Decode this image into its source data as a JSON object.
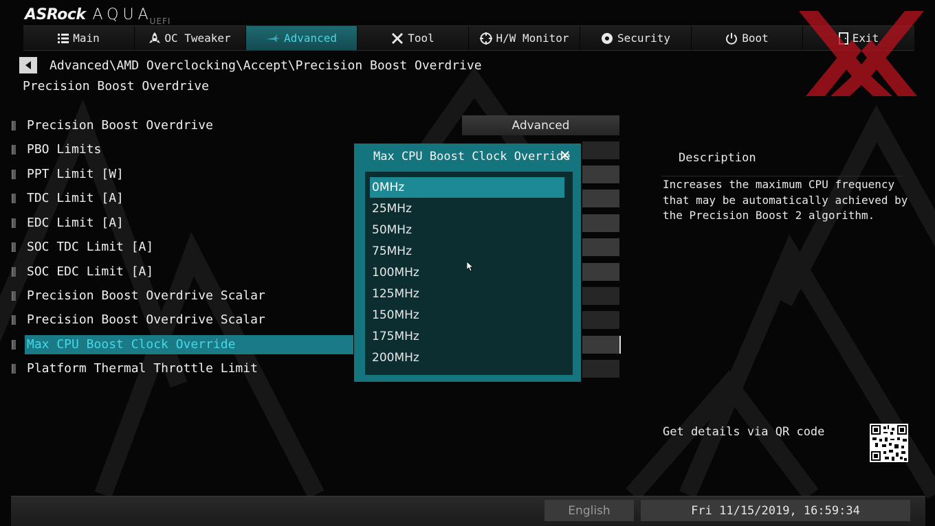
{
  "logo": {
    "brand": "ASRock",
    "series": "AQUA",
    "tag": "UEFI"
  },
  "nav": {
    "tabs": [
      {
        "label": "Main",
        "icon": "list-icon"
      },
      {
        "label": "OC Tweaker",
        "icon": "rocket-icon"
      },
      {
        "label": "Advanced",
        "icon": "jet-icon",
        "active": true
      },
      {
        "label": "Tool",
        "icon": "wrench-icon"
      },
      {
        "label": "H/W Monitor",
        "icon": "crosshair-icon"
      },
      {
        "label": "Security",
        "icon": "shield-icon"
      },
      {
        "label": "Boot",
        "icon": "power-icon"
      },
      {
        "label": "Exit",
        "icon": "exit-door-icon"
      }
    ]
  },
  "breadcrumb": "Advanced\\AMD Overclocking\\Accept\\Precision Boost Overdrive",
  "page_title": "Precision Boost Overdrive",
  "menu": {
    "items": [
      {
        "label": "Precision Boost Overdrive"
      },
      {
        "label": "PBO Limits"
      },
      {
        "label": "PPT Limit [W]"
      },
      {
        "label": "TDC Limit [A]"
      },
      {
        "label": "EDC Limit [A]"
      },
      {
        "label": "SOC TDC Limit [A]"
      },
      {
        "label": "SOC EDC Limit [A]"
      },
      {
        "label": "Precision Boost Overdrive Scalar"
      },
      {
        "label": "Precision Boost Overdrive Scalar"
      },
      {
        "label": "Max CPU Boost Clock Override",
        "selected": true
      },
      {
        "label": "Platform Thermal Throttle Limit"
      }
    ],
    "first_value": "Advanced"
  },
  "modal": {
    "title": "Max CPU Boost Clock Override",
    "options": [
      "0MHz",
      "25MHz",
      "50MHz",
      "75MHz",
      "100MHz",
      "125MHz",
      "150MHz",
      "175MHz",
      "200MHz"
    ],
    "selected_index": 0
  },
  "description": {
    "title": "Description",
    "text": "Increases the maximum CPU frequency that may be automatically achieved by the Precision Boost 2 algorithm.",
    "qr_label": "Get details via QR code"
  },
  "footer": {
    "language": "English",
    "datetime": "Fri 11/15/2019, 16:59:34"
  },
  "colors": {
    "accent": "#1a7b86",
    "accent_text": "#48d7e6",
    "modal_bg": "#15757f",
    "xx_red": "#b3121d"
  }
}
